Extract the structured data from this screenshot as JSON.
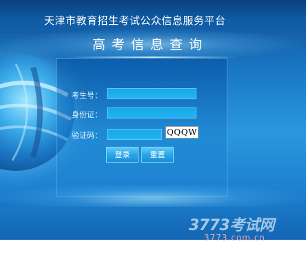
{
  "header": {
    "site_title": "天津市教育招生考试公众信息服务平台",
    "page_title": "高考信息查询"
  },
  "form": {
    "exam_number_label": "考生号：",
    "exam_number_value": "",
    "id_card_label": "身份证：",
    "id_card_value": "",
    "captcha_label": "验证码：",
    "captcha_value": "",
    "captcha_image_text": "QQQW",
    "login_label": "登录",
    "reset_label": "重置"
  },
  "watermark": {
    "brand": "3773考试网",
    "url": "3773.com.cn"
  },
  "colors": {
    "background_dark": "#0f4f93",
    "background_light": "#2a97de",
    "input_fill": "#1aabeb",
    "watermark_url": "#f2a5a5"
  }
}
